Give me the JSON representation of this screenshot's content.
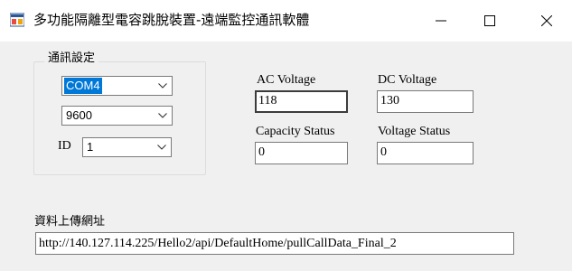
{
  "window": {
    "title": "多功能隔離型電容跳脫裝置-遠端監控通訊軟體",
    "icon": "app-window-icon",
    "controls": [
      "minimize-icon",
      "maximize-icon",
      "close-icon"
    ]
  },
  "comm_settings": {
    "group_title": "通訊設定",
    "port": "COM4",
    "baud_rate": "9600",
    "id_label": "ID",
    "id_value": "1"
  },
  "readings": {
    "ac_voltage_label": "AC Voltage",
    "ac_voltage_value": "118",
    "dc_voltage_label": "DC Voltage",
    "dc_voltage_value": "130",
    "capacity_status_label": "Capacity Status",
    "capacity_status_value": "0",
    "voltage_status_label": "Voltage Status",
    "voltage_status_value": "0"
  },
  "upload": {
    "label": "資料上傳網址",
    "url": "http://140.127.114.225/Hello2/api/DefaultHome/pullCallData_Final_2"
  },
  "colors": {
    "selection": "#0078d7",
    "window_bg": "#f0f0f0",
    "titlebar_bg": "#ffffff"
  }
}
